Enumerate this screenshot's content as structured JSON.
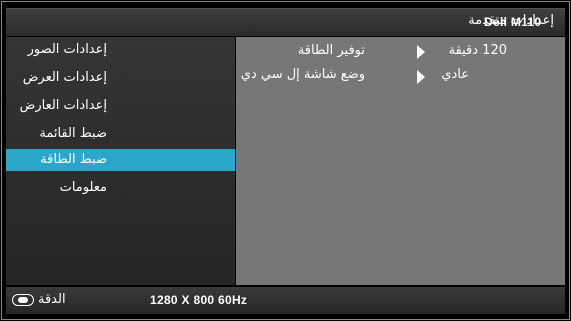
{
  "header": {
    "title": "إعدادات متقدمة",
    "model": "Dell  M110"
  },
  "sidebar": {
    "items": [
      {
        "label": "إعدادات الصور"
      },
      {
        "label": "إعدادات العرض"
      },
      {
        "label": "إعدادات العارض"
      },
      {
        "label": "ضبط القائمة"
      },
      {
        "label": "ضبط الطاقة"
      },
      {
        "label": "معلومات"
      }
    ],
    "active_index": 4
  },
  "content": {
    "settings": [
      {
        "label": "توفير الطاقة",
        "value": "120 دقيقة",
        "icon": "arrow-right-icon"
      },
      {
        "label": "وضع شاشة إل سي دي",
        "value": "عادي",
        "icon": "arrow-right-icon"
      }
    ]
  },
  "footer": {
    "resolution_label": "الدقة",
    "resolution_value": "1280 X 800 60Hz",
    "icon": "input-source-icon"
  },
  "colors": {
    "accent": "#2aa6c8",
    "content_bg": "#777777",
    "background": "#000000"
  }
}
